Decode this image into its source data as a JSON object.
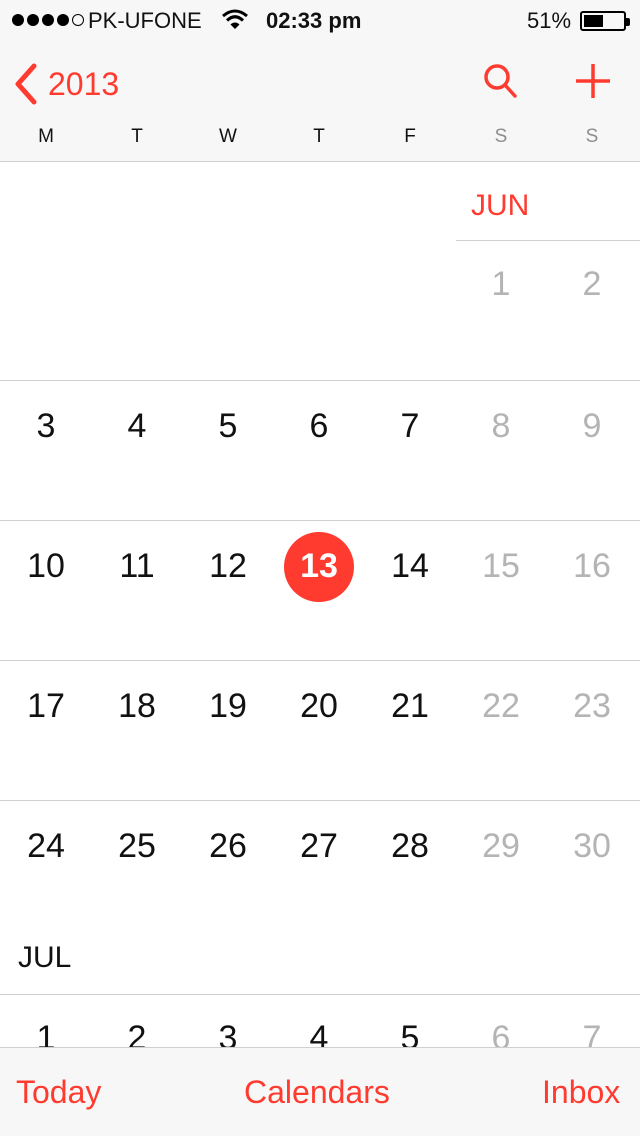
{
  "status_bar": {
    "carrier": "PK-UFONE",
    "time": "02:33 pm",
    "battery": "51%",
    "battery_level": 0.51,
    "signal_bars": 4,
    "signal_max": 5
  },
  "nav": {
    "back_label": "2013",
    "back_icon": "chevron-left-icon",
    "search_icon": "search-icon",
    "add_icon": "plus-icon"
  },
  "weekdays": [
    "M",
    "T",
    "W",
    "T",
    "F",
    "S",
    "S"
  ],
  "months": [
    {
      "label": "JUN",
      "weeks": [
        [
          "",
          "",
          "",
          "",
          "",
          "1",
          "2"
        ],
        [
          "3",
          "4",
          "5",
          "6",
          "7",
          "8",
          "9"
        ],
        [
          "10",
          "11",
          "12",
          "13",
          "14",
          "15",
          "16"
        ],
        [
          "17",
          "18",
          "19",
          "20",
          "21",
          "22",
          "23"
        ],
        [
          "24",
          "25",
          "26",
          "27",
          "28",
          "29",
          "30"
        ]
      ]
    },
    {
      "label": "JUL",
      "weeks": [
        [
          "1",
          "2",
          "3",
          "4",
          "5",
          "6",
          "7"
        ]
      ]
    }
  ],
  "today": "13",
  "tabs": {
    "today": "Today",
    "calendars": "Calendars",
    "inbox": "Inbox"
  },
  "colors": {
    "accent": "#ff3b30",
    "weekend_text": "#b4b4b4",
    "separator": "#cfcfcf"
  }
}
